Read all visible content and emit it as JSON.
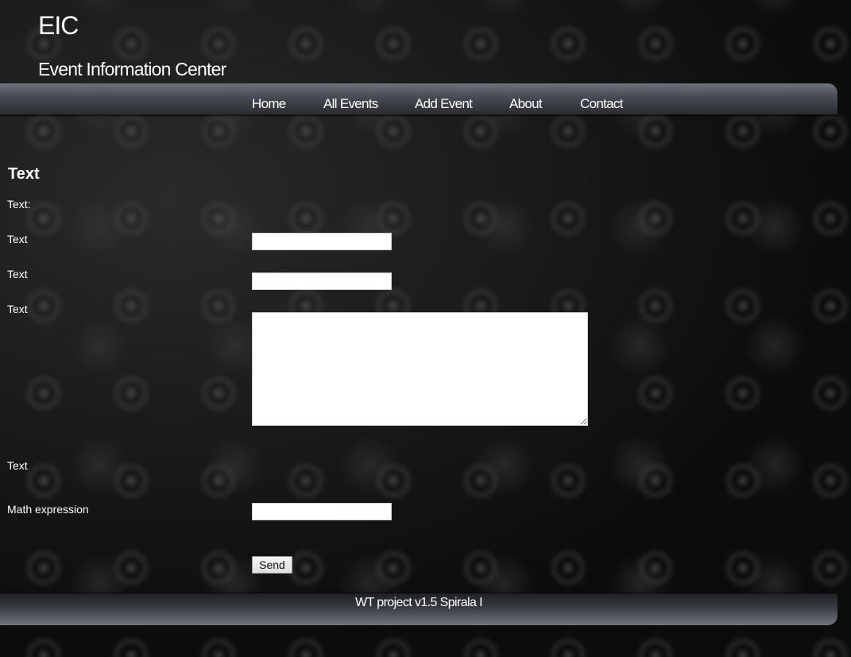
{
  "header": {
    "title": "EIC",
    "subtitle": "Event Information Center"
  },
  "nav": {
    "items": [
      {
        "label": "Home"
      },
      {
        "label": "All Events"
      },
      {
        "label": "Add Event"
      },
      {
        "label": "About"
      },
      {
        "label": "Contact"
      }
    ]
  },
  "form": {
    "heading": "Text",
    "intro_label": "Text:",
    "fields": [
      {
        "label": "Text",
        "value": ""
      },
      {
        "label": "Text",
        "value": ""
      },
      {
        "label": "Text",
        "value": ""
      },
      {
        "label": "Text"
      },
      {
        "label": "Math expression",
        "value": ""
      }
    ],
    "submit_label": "Send"
  },
  "footer": {
    "text": "WT project v1.5 Spirala I"
  }
}
